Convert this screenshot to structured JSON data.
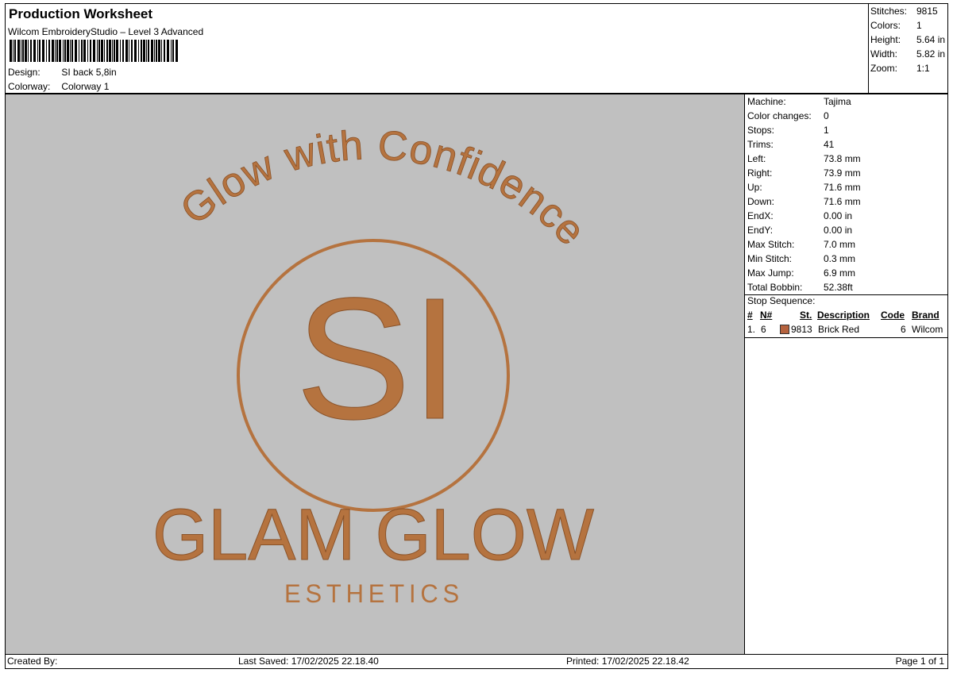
{
  "header": {
    "title": "Production Worksheet",
    "software": "Wilcom EmbroideryStudio – Level 3 Advanced",
    "design_label": "Design:",
    "design_value": "SI back 5,8in",
    "colorway_label": "Colorway:",
    "colorway_value": "Colorway 1"
  },
  "summary": {
    "stitches_label": "Stitches:",
    "stitches_value": "9815",
    "colors_label": "Colors:",
    "colors_value": "1",
    "height_label": "Height:",
    "height_value": "5.64 in",
    "width_label": "Width:",
    "width_value": "5.82 in",
    "zoom_label": "Zoom:",
    "zoom_value": "1:1"
  },
  "details": {
    "rows": [
      {
        "label": "Machine:",
        "value": "Tajima"
      },
      {
        "label": "Color changes:",
        "value": "0"
      },
      {
        "label": "Stops:",
        "value": "1"
      },
      {
        "label": "Trims:",
        "value": "41"
      },
      {
        "label": "Left:",
        "value": "73.8 mm"
      },
      {
        "label": "Right:",
        "value": "73.9 mm"
      },
      {
        "label": "Up:",
        "value": "71.6 mm"
      },
      {
        "label": "Down:",
        "value": "71.6 mm"
      },
      {
        "label": "EndX:",
        "value": "0.00 in"
      },
      {
        "label": "EndY:",
        "value": "0.00 in"
      },
      {
        "label": "Max Stitch:",
        "value": "7.0 mm"
      },
      {
        "label": "Min Stitch:",
        "value": "0.3 mm"
      },
      {
        "label": "Max Jump:",
        "value": "6.9 mm"
      },
      {
        "label": "Total Bobbin:",
        "value": "52.38ft"
      }
    ],
    "stop_sequence_label": "Stop Sequence:",
    "columns": {
      "hash": "#",
      "n": "N#",
      "st": "St.",
      "description": "Description",
      "code": "Code",
      "brand": "Brand"
    },
    "stop": {
      "index": "1.",
      "n": "6",
      "st": "9813",
      "description": "Brick Red",
      "code": "6",
      "brand": "Wilcom",
      "color": "#b5623e"
    }
  },
  "design": {
    "arc_text": "Glow with Confidence",
    "monogram": "SI",
    "brand": "GLAM GLOW",
    "tagline": "ESTHETICS",
    "thread_color": "#b5733f",
    "background": "#c0c0c0"
  },
  "footer": {
    "created_by": "Created By:",
    "last_saved": "Last Saved: 17/02/2025 22.18.40",
    "printed": "Printed: 17/02/2025 22.18.42",
    "page": "Page 1 of 1"
  }
}
